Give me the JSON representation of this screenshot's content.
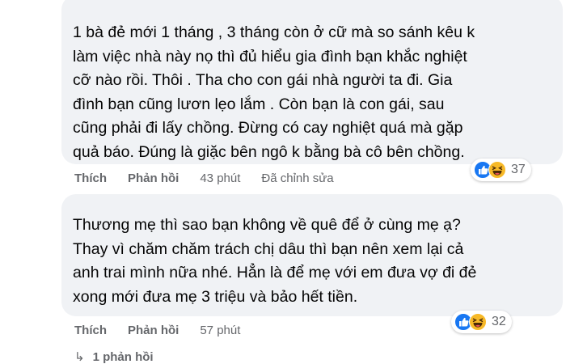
{
  "comments": [
    {
      "text": "1 bà đẻ mới 1 tháng , 3 tháng còn ở cữ mà so sánh kêu k\nlàm việc nhà này nọ thì đủ hiểu gia đình bạn khắc nghiệt\ncỡ nào rồi. Thôi . Tha cho con gái nhà người ta đi. Gia\nđình bạn cũng lươn lẹo lắm . Còn bạn là con gái, sau\ncũng phải đi lấy chồng. Đừng có cay nghiệt quá mà gặp\nquả báo. Đúng là giặc bên ngô k bằng bà cô bên chồng.",
      "like_label": "Thích",
      "reply_label": "Phản hồi",
      "time": "43 phút",
      "edited": "Đã chỉnh sửa",
      "reaction_count": "37",
      "reaction_icons": [
        "like-icon",
        "haha-icon"
      ]
    },
    {
      "text": "Thương mẹ thì sao bạn không về quê để ở cùng mẹ ạ?\nThay vì chăm chăm trách chị dâu thì bạn nên xem lại cả\nanh trai mình nữa nhé. Hẳn là để mẹ với em đưa vợ đi đẻ\nxong mới đưa mẹ 3 triệu và bảo hết tiền.",
      "like_label": "Thích",
      "reply_label": "Phản hồi",
      "time": "57 phút",
      "reaction_count": "32",
      "reaction_icons": [
        "like-icon",
        "haha-icon"
      ]
    }
  ],
  "replies_link": "1 phản hồi",
  "colors": {
    "bubble": "#f0f2f5",
    "meta_text": "#65676b",
    "like_blue": "#1877f2",
    "haha_yellow": "#f7b928"
  }
}
